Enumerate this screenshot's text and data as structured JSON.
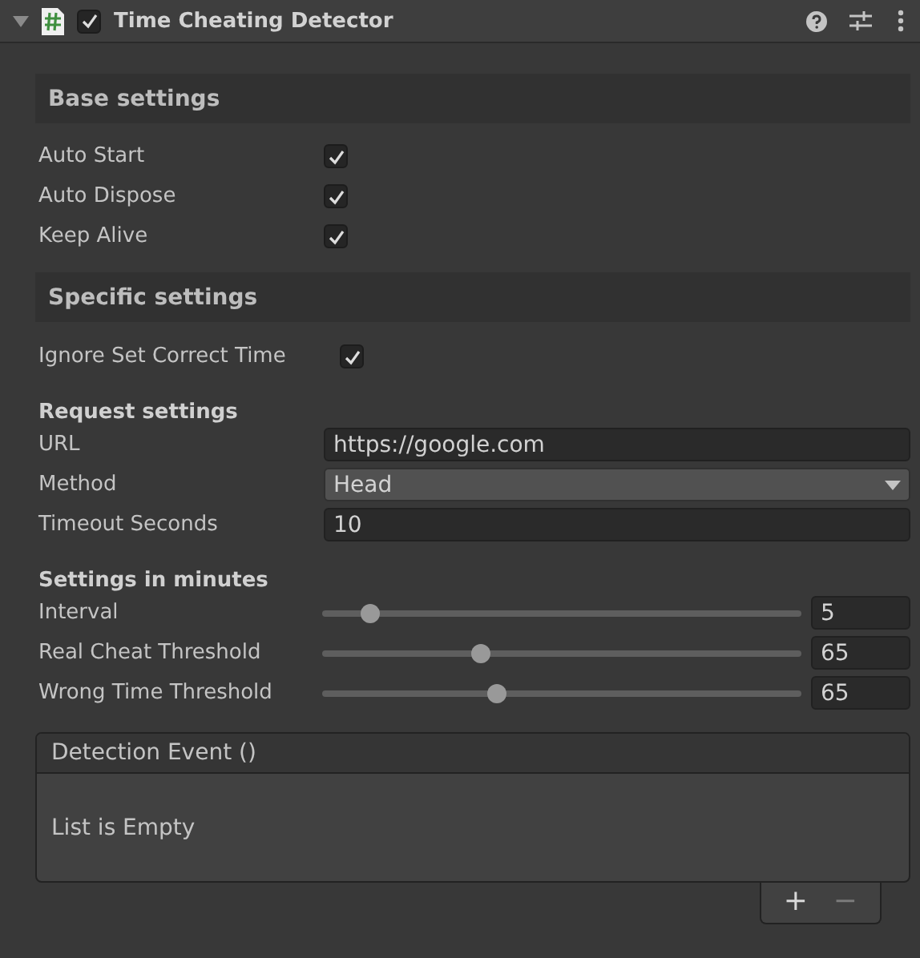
{
  "component": {
    "title": "Time Cheating Detector",
    "expanded": true,
    "enabled": true
  },
  "base_settings": {
    "title": "Base settings",
    "toggles": [
      {
        "label": "Auto Start",
        "checked": true
      },
      {
        "label": "Auto Dispose",
        "checked": true
      },
      {
        "label": "Keep Alive",
        "checked": true
      }
    ]
  },
  "specific_settings": {
    "title": "Specific settings",
    "toggle": {
      "label": "Ignore Set Correct Time",
      "checked": true
    }
  },
  "request_settings": {
    "title": "Request settings",
    "fields": [
      {
        "kind": "text",
        "label": "URL",
        "value": "https://google.com"
      },
      {
        "kind": "dropdown",
        "label": "Method",
        "value": "Head"
      },
      {
        "kind": "text",
        "label": "Timeout Seconds",
        "value": "10"
      }
    ]
  },
  "minutes_settings": {
    "title": "Settings in minutes",
    "sliders": [
      {
        "label": "Interval",
        "level": 0.1,
        "value": "5"
      },
      {
        "label": "Real Cheat Threshold",
        "level": 0.33,
        "value": "65"
      },
      {
        "label": "Wrong Time Threshold",
        "level": 0.363,
        "value": "65"
      }
    ]
  },
  "event_list": {
    "title": "Detection Event ()",
    "empty_text": "List is Empty",
    "add": "+",
    "remove": "−",
    "remove_disabled": true
  }
}
